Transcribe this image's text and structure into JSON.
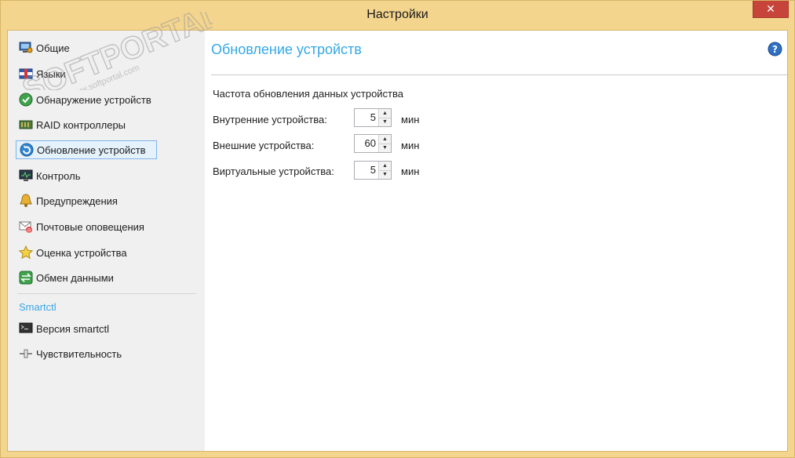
{
  "window": {
    "title": "Настройки",
    "close_glyph": "✕"
  },
  "sidebar": {
    "items": [
      {
        "label": "Общие",
        "icon": "monitor-settings-icon"
      },
      {
        "label": "Языки",
        "icon": "language-flag-icon"
      },
      {
        "label": "Обнаружение устройств",
        "icon": "device-discovery-icon"
      },
      {
        "label": "RAID контроллеры",
        "icon": "raid-controller-icon"
      },
      {
        "label": "Обновление устройств",
        "icon": "refresh-icon",
        "selected": true
      },
      {
        "label": "Контроль",
        "icon": "monitor-chart-icon"
      },
      {
        "label": "Предупреждения",
        "icon": "bell-icon"
      },
      {
        "label": "Почтовые оповещения",
        "icon": "mail-icon"
      },
      {
        "label": "Оценка устройства",
        "icon": "star-icon"
      },
      {
        "label": "Обмен данными",
        "icon": "data-exchange-icon"
      }
    ],
    "group": {
      "label": "Smartctl",
      "items": [
        {
          "label": "Версия smartctl",
          "icon": "terminal-icon"
        },
        {
          "label": "Чувствительность",
          "icon": "slider-icon"
        }
      ]
    }
  },
  "content": {
    "title": "Обновление устройств",
    "help_icon": "help-icon",
    "section_label": "Частота обновления данных устройства",
    "rows": [
      {
        "label": "Внутренние устройства:",
        "value": "5",
        "unit": "мин"
      },
      {
        "label": "Внешние устройства:",
        "value": "60",
        "unit": "мин"
      },
      {
        "label": "Виртуальные устройства:",
        "value": "5",
        "unit": "мин"
      }
    ]
  },
  "watermark": {
    "text": "SOFTPORTAL",
    "url": "www.softportal.com",
    "tm": "TM"
  },
  "colors": {
    "accent": "#35a8e6",
    "frame": "#f4d58e",
    "close": "#c7443b",
    "selected_bg": "#e5f1fb",
    "selected_border": "#7eb4ea"
  }
}
